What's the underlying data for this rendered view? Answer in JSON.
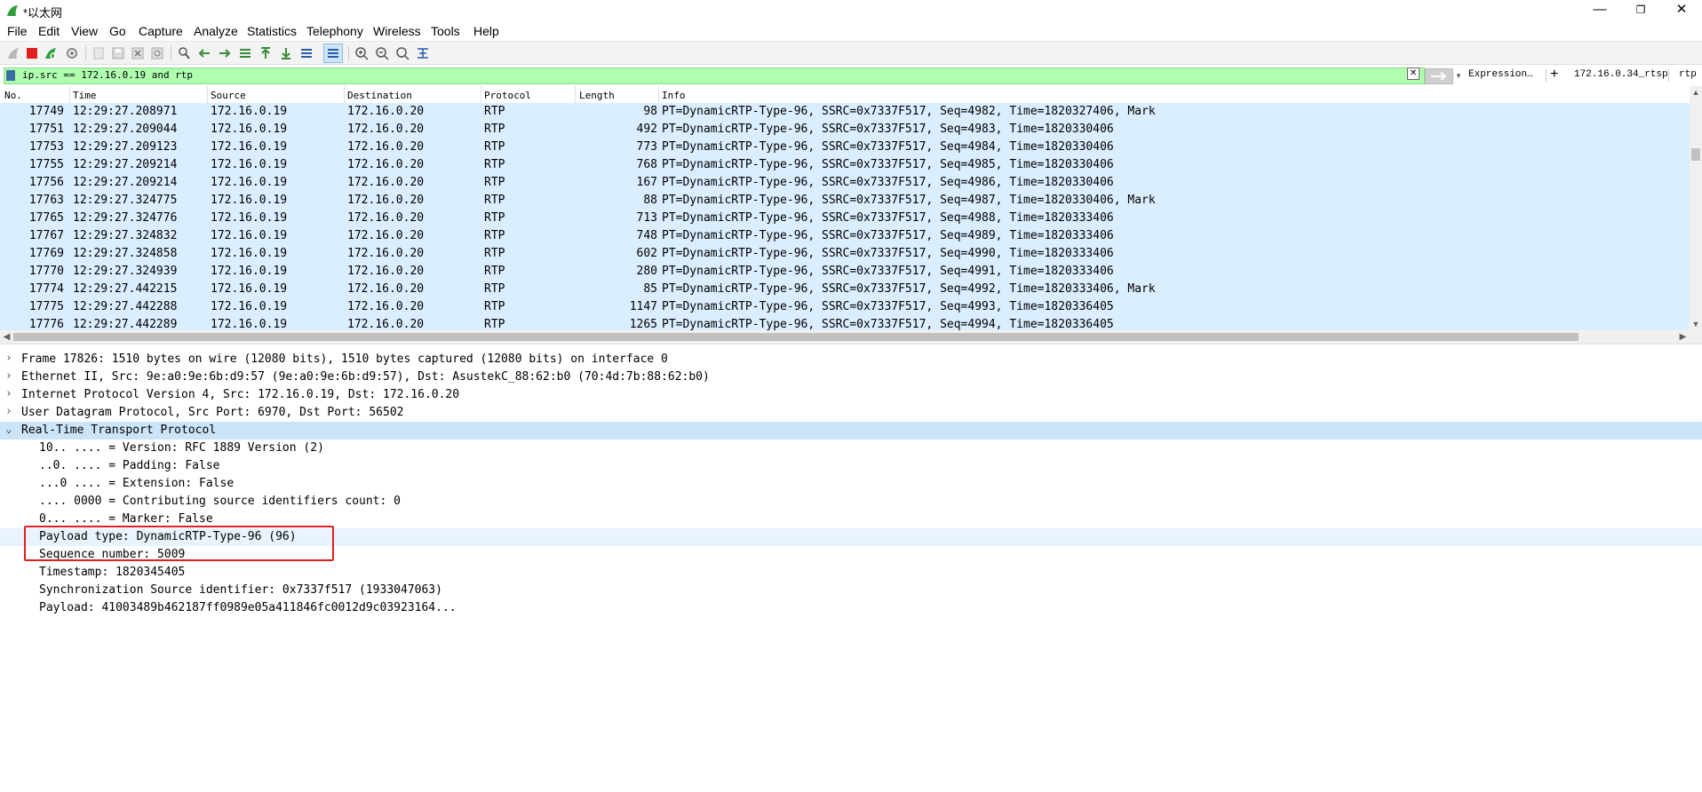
{
  "window": {
    "title": "*以太网",
    "minimize_glyph": "—",
    "restore_glyph": "❐",
    "close_glyph": "✕"
  },
  "menu": [
    "File",
    "Edit",
    "View",
    "Go",
    "Capture",
    "Analyze",
    "Statistics",
    "Telephony",
    "Wireless",
    "Tools",
    "Help"
  ],
  "toolbar_icons": [
    "shark-fin-start-icon",
    "stop-capture-icon",
    "restart-capture-icon",
    "capture-options-icon",
    "open-file-icon",
    "save-file-icon",
    "close-file-icon",
    "reload-file-icon",
    "find-packet-icon",
    "go-back-icon",
    "go-forward-icon",
    "go-to-packet-icon",
    "first-packet-icon",
    "last-packet-icon",
    "autoscroll-icon",
    "colorize-icon",
    "zoom-in-icon",
    "zoom-out-icon",
    "zoom-normal-icon",
    "resize-columns-icon"
  ],
  "filter": {
    "text": "ip.src == 172.16.0.19 and rtp",
    "clear_glyph": "✕",
    "dropdown_glyph": "▾",
    "expression_label": "Expression…",
    "add_glyph": "+",
    "buttons": [
      "172.16.0.34_rtsp",
      "rtp"
    ]
  },
  "packet_list": {
    "columns": [
      "No.",
      "Time",
      "Source",
      "Destination",
      "Protocol",
      "Length",
      "Info"
    ],
    "rows": [
      {
        "no": "17749",
        "time": "12:29:27.208971",
        "source": "172.16.0.19",
        "destination": "172.16.0.20",
        "protocol": "RTP",
        "length": "98",
        "info": "PT=DynamicRTP-Type-96, SSRC=0x7337F517, Seq=4982, Time=1820327406, Mark"
      },
      {
        "no": "17751",
        "time": "12:29:27.209044",
        "source": "172.16.0.19",
        "destination": "172.16.0.20",
        "protocol": "RTP",
        "length": "492",
        "info": "PT=DynamicRTP-Type-96, SSRC=0x7337F517, Seq=4983, Time=1820330406"
      },
      {
        "no": "17753",
        "time": "12:29:27.209123",
        "source": "172.16.0.19",
        "destination": "172.16.0.20",
        "protocol": "RTP",
        "length": "773",
        "info": "PT=DynamicRTP-Type-96, SSRC=0x7337F517, Seq=4984, Time=1820330406"
      },
      {
        "no": "17755",
        "time": "12:29:27.209214",
        "source": "172.16.0.19",
        "destination": "172.16.0.20",
        "protocol": "RTP",
        "length": "768",
        "info": "PT=DynamicRTP-Type-96, SSRC=0x7337F517, Seq=4985, Time=1820330406"
      },
      {
        "no": "17756",
        "time": "12:29:27.209214",
        "source": "172.16.0.19",
        "destination": "172.16.0.20",
        "protocol": "RTP",
        "length": "167",
        "info": "PT=DynamicRTP-Type-96, SSRC=0x7337F517, Seq=4986, Time=1820330406"
      },
      {
        "no": "17763",
        "time": "12:29:27.324775",
        "source": "172.16.0.19",
        "destination": "172.16.0.20",
        "protocol": "RTP",
        "length": "88",
        "info": "PT=DynamicRTP-Type-96, SSRC=0x7337F517, Seq=4987, Time=1820330406, Mark"
      },
      {
        "no": "17765",
        "time": "12:29:27.324776",
        "source": "172.16.0.19",
        "destination": "172.16.0.20",
        "protocol": "RTP",
        "length": "713",
        "info": "PT=DynamicRTP-Type-96, SSRC=0x7337F517, Seq=4988, Time=1820333406"
      },
      {
        "no": "17767",
        "time": "12:29:27.324832",
        "source": "172.16.0.19",
        "destination": "172.16.0.20",
        "protocol": "RTP",
        "length": "748",
        "info": "PT=DynamicRTP-Type-96, SSRC=0x7337F517, Seq=4989, Time=1820333406"
      },
      {
        "no": "17769",
        "time": "12:29:27.324858",
        "source": "172.16.0.19",
        "destination": "172.16.0.20",
        "protocol": "RTP",
        "length": "602",
        "info": "PT=DynamicRTP-Type-96, SSRC=0x7337F517, Seq=4990, Time=1820333406"
      },
      {
        "no": "17770",
        "time": "12:29:27.324939",
        "source": "172.16.0.19",
        "destination": "172.16.0.20",
        "protocol": "RTP",
        "length": "280",
        "info": "PT=DynamicRTP-Type-96, SSRC=0x7337F517, Seq=4991, Time=1820333406"
      },
      {
        "no": "17774",
        "time": "12:29:27.442215",
        "source": "172.16.0.19",
        "destination": "172.16.0.20",
        "protocol": "RTP",
        "length": "85",
        "info": "PT=DynamicRTP-Type-96, SSRC=0x7337F517, Seq=4992, Time=1820333406, Mark"
      },
      {
        "no": "17775",
        "time": "12:29:27.442288",
        "source": "172.16.0.19",
        "destination": "172.16.0.20",
        "protocol": "RTP",
        "length": "1147",
        "info": "PT=DynamicRTP-Type-96, SSRC=0x7337F517, Seq=4993, Time=1820336405"
      },
      {
        "no": "17776",
        "time": "12:29:27.442289",
        "source": "172.16.0.19",
        "destination": "172.16.0.20",
        "protocol": "RTP",
        "length": "1265",
        "info": "PT=DynamicRTP-Type-96, SSRC=0x7337F517, Seq=4994, Time=1820336405"
      }
    ],
    "row_background": "#daeeff"
  },
  "details": {
    "collapsed_glyph": "›",
    "expanded_glyph": "⌄",
    "tree": [
      {
        "text": "Frame 17826: 1510 bytes on wire (12080 bits), 1510 bytes captured (12080 bits) on interface 0",
        "expandable": true,
        "expanded": false
      },
      {
        "text": "Ethernet II, Src: 9e:a0:9e:6b:d9:57 (9e:a0:9e:6b:d9:57), Dst: AsustekC_88:62:b0 (70:4d:7b:88:62:b0)",
        "expandable": true,
        "expanded": false
      },
      {
        "text": "Internet Protocol Version 4, Src: 172.16.0.19, Dst: 172.16.0.20",
        "expandable": true,
        "expanded": false
      },
      {
        "text": "User Datagram Protocol, Src Port: 6970, Dst Port: 56502",
        "expandable": true,
        "expanded": false
      },
      {
        "text": "Real-Time Transport Protocol",
        "expandable": true,
        "expanded": true,
        "selected": true
      },
      {
        "text": "10.. .... = Version: RFC 1889 Version (2)",
        "child": true
      },
      {
        "text": "..0. .... = Padding: False",
        "child": true
      },
      {
        "text": "...0 .... = Extension: False",
        "child": true
      },
      {
        "text": ".... 0000 = Contributing source identifiers count: 0",
        "child": true
      },
      {
        "text": "0... .... = Marker: False",
        "child": true
      },
      {
        "text": "Payload type: DynamicRTP-Type-96 (96)",
        "child": true,
        "highlighted": true
      },
      {
        "text": "Sequence number: 5009",
        "child": true
      },
      {
        "text": "Timestamp: 1820345405",
        "child": true
      },
      {
        "text": "Synchronization Source identifier: 0x7337f517 (1933047063)",
        "child": true
      },
      {
        "text": "Payload: 41003489b462187ff0989e05a411846fc0012d9c03923164...",
        "child": true
      }
    ]
  },
  "annotation_color": "#e02020"
}
